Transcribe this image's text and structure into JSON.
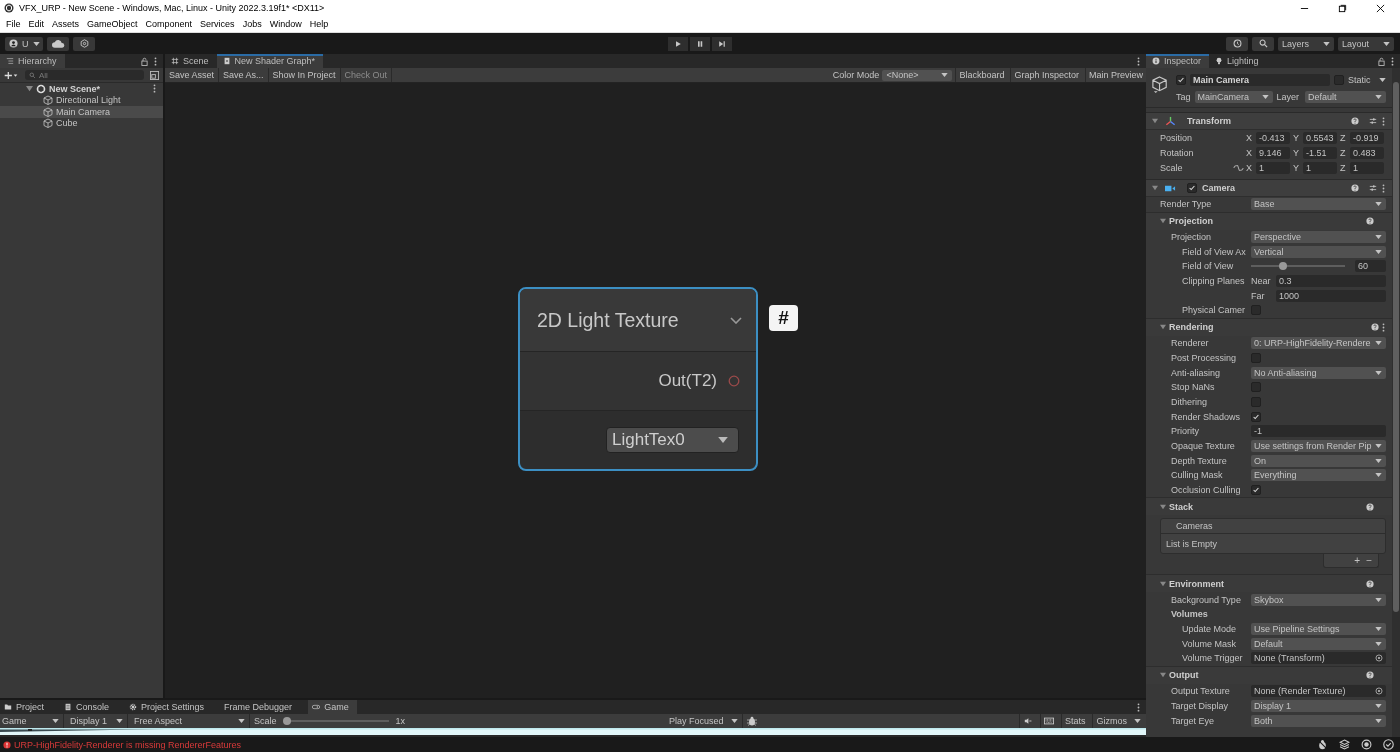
{
  "window": {
    "title": "VFX_URP - New Scene - Windows, Mac, Linux - Unity 2022.3.19f1* <DX11>"
  },
  "menu": [
    "File",
    "Edit",
    "Assets",
    "GameObject",
    "Component",
    "Services",
    "Jobs",
    "Window",
    "Help"
  ],
  "toolbar": {
    "account": "U",
    "layers": "Layers",
    "layout": "Layout"
  },
  "hierarchy": {
    "title": "Hierarchy",
    "search_placeholder": "All",
    "scene": {
      "name": "New Scene*",
      "expanded": true,
      "children": [
        {
          "name": "Directional Light",
          "selected": false
        },
        {
          "name": "Main Camera",
          "selected": true
        },
        {
          "name": "Cube",
          "selected": false
        }
      ]
    }
  },
  "editor_tabs": [
    {
      "label": "Scene",
      "selected": false
    },
    {
      "label": "New Shader Graph*",
      "selected": true
    }
  ],
  "graph_toolbar": {
    "buttons": [
      {
        "label": "Save Asset",
        "disabled": false
      },
      {
        "label": "Save As...",
        "disabled": false
      },
      {
        "label": "Show In Project",
        "disabled": false
      },
      {
        "label": "Check Out",
        "disabled": true
      }
    ],
    "color_mode_label": "Color Mode",
    "color_mode": "<None>",
    "toggles": [
      "Blackboard",
      "Graph Inspector",
      "Main Preview"
    ]
  },
  "node": {
    "title": "2D Light Texture",
    "output": "Out(T2)",
    "dropdown": "LightTex0",
    "property_badge": "#"
  },
  "inspector": {
    "tabs": [
      {
        "label": "Inspector",
        "selected": true
      },
      {
        "label": "Lighting",
        "selected": false
      }
    ],
    "object": {
      "active": true,
      "name": "Main Camera",
      "static": false,
      "static_label": "Static",
      "tag_label": "Tag",
      "tag": "MainCamera",
      "layer_label": "Layer",
      "layer": "Default"
    },
    "transform": {
      "title": "Transform",
      "rows": [
        {
          "label": "Position",
          "fields": [
            {
              "axis": "X",
              "value": "-0.413"
            },
            {
              "axis": "Y",
              "value": "0.5543"
            },
            {
              "axis": "Z",
              "value": "-0.919"
            }
          ]
        },
        {
          "label": "Rotation",
          "fields": [
            {
              "axis": "X",
              "value": "9.146"
            },
            {
              "axis": "Y",
              "value": "-1.51"
            },
            {
              "axis": "Z",
              "value": "0.483"
            }
          ]
        },
        {
          "label": "Scale",
          "proportional": false,
          "fields": [
            {
              "axis": "X",
              "value": "1"
            },
            {
              "axis": "Y",
              "value": "1"
            },
            {
              "axis": "Z",
              "value": "1"
            }
          ]
        }
      ]
    },
    "camera": {
      "title": "Camera",
      "enabled": true,
      "rows": [
        {
          "kind": "dropdown",
          "label": "Render Type",
          "value": "Base"
        }
      ],
      "sections": [
        {
          "title": "Projection",
          "rows": [
            {
              "kind": "dropdown",
              "label": "Projection",
              "value": "Perspective",
              "children": [
                {
                  "kind": "dropdown",
                  "label": "Field of View Ax",
                  "value": "Vertical"
                },
                {
                  "kind": "slider",
                  "label": "Field of View",
                  "level": 0.34,
                  "value": "60"
                },
                {
                  "kind": "clip",
                  "label": "Clipping Planes",
                  "fields": [
                    {
                      "label": "Near",
                      "value": "0.3"
                    },
                    {
                      "label": "Far",
                      "value": "1000"
                    }
                  ]
                },
                {
                  "kind": "checkbox",
                  "label": "Physical Camer",
                  "checked": false
                }
              ]
            }
          ]
        },
        {
          "title": "Rendering",
          "menu": true,
          "rows": [
            {
              "kind": "dropdown",
              "label": "Renderer",
              "value": "0: URP-HighFidelity-Rendere"
            },
            {
              "kind": "checkbox",
              "label": "Post Processing",
              "checked": false
            },
            {
              "kind": "dropdown",
              "label": "Anti-aliasing",
              "value": "No Anti-aliasing"
            },
            {
              "kind": "checkbox",
              "label": "Stop NaNs",
              "checked": false
            },
            {
              "kind": "checkbox",
              "label": "Dithering",
              "checked": false
            },
            {
              "kind": "checkbox",
              "label": "Render Shadows",
              "checked": true
            },
            {
              "kind": "text",
              "label": "Priority",
              "value": "-1"
            },
            {
              "kind": "dropdown",
              "label": "Opaque Texture",
              "value": "Use settings from Render Pip"
            },
            {
              "kind": "dropdown",
              "label": "Depth Texture",
              "value": "On"
            },
            {
              "kind": "dropdown",
              "label": "Culling Mask",
              "value": "Everything"
            },
            {
              "kind": "checkbox",
              "label": "Occlusion Culling",
              "checked": true
            }
          ]
        },
        {
          "title": "Stack",
          "rows": [
            {
              "kind": "list",
              "header": "Cameras",
              "empty": "List is Empty",
              "add": "+",
              "remove": "−"
            }
          ]
        },
        {
          "title": "Environment",
          "rows": [
            {
              "kind": "dropdown",
              "label": "Background Type",
              "value": "Skybox"
            },
            {
              "kind": "group",
              "label": "Volumes",
              "children": [
                {
                  "kind": "dropdown",
                  "label": "Update Mode",
                  "value": "Use Pipeline Settings"
                },
                {
                  "kind": "dropdown",
                  "label": "Volume Mask",
                  "value": "Default"
                },
                {
                  "kind": "object",
                  "label": "Volume Trigger",
                  "value": "None (Transform)"
                }
              ]
            }
          ]
        },
        {
          "title": "Output",
          "rows": [
            {
              "kind": "object",
              "label": "Output Texture",
              "value": "None (Render Texture)"
            },
            {
              "kind": "dropdown",
              "label": "Target Display",
              "value": "Display 1"
            },
            {
              "kind": "dropdown",
              "label": "Target Eye",
              "value": "Both"
            }
          ]
        }
      ]
    }
  },
  "bottom_tabs": [
    {
      "label": "Project",
      "selected": false
    },
    {
      "label": "Console",
      "selected": false
    },
    {
      "label": "Project Settings",
      "selected": false
    },
    {
      "label": "Frame Debugger",
      "selected": false
    },
    {
      "label": "Game",
      "selected": true
    }
  ],
  "game_toolbar": {
    "view": "Game",
    "display": "Display 1",
    "aspect": "Free Aspect",
    "scale_label": "Scale",
    "scale": {
      "level": 0
    },
    "scale_value": "1x",
    "play_mode": "Play Focused",
    "stats": "Stats",
    "gizmos": "Gizmos"
  },
  "status_bar": {
    "kind": "error",
    "message": "URP-HighFidelity-Renderer is missing RendererFeatures"
  }
}
